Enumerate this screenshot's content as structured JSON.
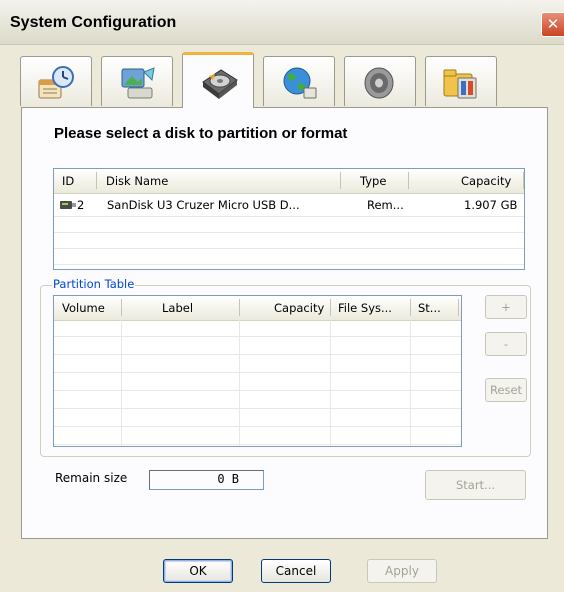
{
  "window": {
    "title": "System Configuration",
    "close_symbol": "✕"
  },
  "tabs": [
    {
      "icon": "scheduled-task-icon",
      "active": false
    },
    {
      "icon": "display-icon",
      "active": false
    },
    {
      "icon": "hard-disk-icon",
      "active": true
    },
    {
      "icon": "network-globe-icon",
      "active": false
    },
    {
      "icon": "speaker-icon",
      "active": false
    },
    {
      "icon": "system-folder-icon",
      "active": false
    }
  ],
  "heading": "Please select a disk to partition or format",
  "disk_list": {
    "columns": [
      "ID",
      "Disk Name",
      "Type",
      "Capacity"
    ],
    "rows": [
      {
        "id": "2",
        "name": "SanDisk U3 Cruzer Micro USB D...",
        "type": "Rem...",
        "capacity": "1.907 GB",
        "icon": "usb-drive-icon"
      }
    ]
  },
  "partition_table": {
    "group_label": "Partition Table",
    "columns": [
      "Volume",
      "Label",
      "Capacity",
      "File Sys...",
      "St..."
    ],
    "rows": []
  },
  "side_buttons": {
    "add": "+",
    "remove": "-",
    "reset": "Reset"
  },
  "remain": {
    "label": "Remain size",
    "value": "0 B"
  },
  "start_button": "Start...",
  "footer": {
    "ok": "OK",
    "cancel": "Cancel",
    "apply": "Apply"
  }
}
